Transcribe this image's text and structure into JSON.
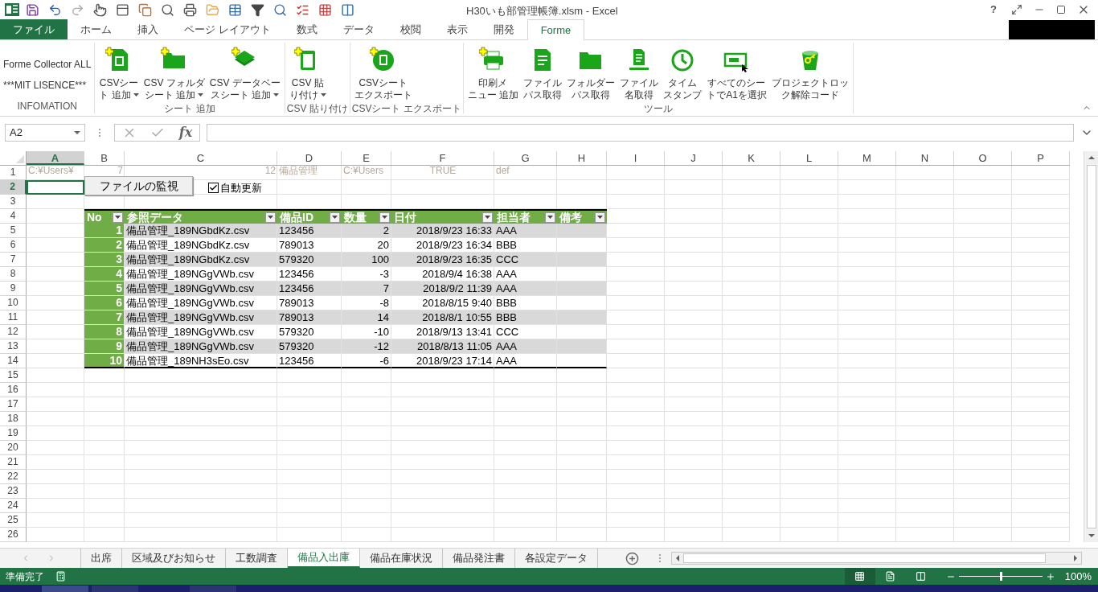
{
  "window": {
    "title": "H30いも部管理帳簿.xlsm - Excel",
    "help": "?"
  },
  "ribbon_tabs": [
    {
      "label": "ファイル",
      "kind": "file",
      "selected": false
    },
    {
      "label": "ホーム",
      "kind": "tab",
      "selected": false
    },
    {
      "label": "挿入",
      "kind": "tab",
      "selected": false
    },
    {
      "label": "ページ レイアウト",
      "kind": "tab",
      "selected": false
    },
    {
      "label": "数式",
      "kind": "tab",
      "selected": false
    },
    {
      "label": "データ",
      "kind": "tab",
      "selected": false
    },
    {
      "label": "校閲",
      "kind": "tab",
      "selected": false
    },
    {
      "label": "表示",
      "kind": "tab",
      "selected": false
    },
    {
      "label": "開発",
      "kind": "tab",
      "selected": false
    },
    {
      "label": "Forme",
      "kind": "tab",
      "selected": true
    }
  ],
  "ribbon_groups": [
    {
      "label": "INFOMATION",
      "kind": "info",
      "lines": [
        "Forme Collector ALL",
        "***MIT LISENCE***"
      ]
    },
    {
      "label": "シート 追加",
      "kind": "buttons",
      "buttons": [
        {
          "lines": [
            "CSVシー",
            "ト 追加"
          ],
          "dropdown": true
        },
        {
          "lines": [
            "CSV フォルダ",
            "シート 追加"
          ],
          "dropdown": true
        },
        {
          "lines": [
            "CSV データベー",
            "スシート 追加"
          ],
          "dropdown": true
        }
      ]
    },
    {
      "label": "CSV 貼り付け",
      "kind": "buttons",
      "buttons": [
        {
          "lines": [
            "CSV 貼",
            "り付け"
          ],
          "dropdown": true
        }
      ]
    },
    {
      "label": "CSVシート エクスポート",
      "kind": "buttons",
      "buttons": [
        {
          "lines": [
            "CSVシート",
            "エクスポート"
          ],
          "dropdown": false
        }
      ]
    },
    {
      "label": "ツール",
      "kind": "buttons",
      "buttons": [
        {
          "lines": [
            "印刷メ",
            "ニュー 追加"
          ],
          "dropdown": false
        },
        {
          "lines": [
            "ファイル",
            "パス取得"
          ],
          "dropdown": false
        },
        {
          "lines": [
            "フォルダー",
            "パス取得"
          ],
          "dropdown": false
        },
        {
          "lines": [
            "ファイル",
            "名取得"
          ],
          "dropdown": false
        },
        {
          "lines": [
            "タイム",
            "スタンプ"
          ],
          "dropdown": false
        },
        {
          "lines": [
            "すべてのシー",
            "トでA1を選択"
          ],
          "dropdown": false
        },
        {
          "lines": [
            "プロジェクトロッ",
            "ク解除コード"
          ],
          "dropdown": false
        }
      ]
    }
  ],
  "formula_bar": {
    "name_box": "A2",
    "function_label": "fx"
  },
  "sheet": {
    "columns": [
      {
        "label": "A",
        "selected": true
      },
      {
        "label": "B",
        "selected": false
      },
      {
        "label": "C",
        "selected": false
      },
      {
        "label": "D",
        "selected": false
      },
      {
        "label": "E",
        "selected": false
      },
      {
        "label": "F",
        "selected": false
      },
      {
        "label": "G",
        "selected": false
      },
      {
        "label": "H",
        "selected": false
      },
      {
        "label": "I",
        "selected": false
      },
      {
        "label": "J",
        "selected": false
      },
      {
        "label": "K",
        "selected": false
      },
      {
        "label": "L",
        "selected": false
      },
      {
        "label": "M",
        "selected": false
      },
      {
        "label": "N",
        "selected": false
      },
      {
        "label": "O",
        "selected": false
      },
      {
        "label": "P",
        "selected": false
      }
    ],
    "rows": [
      {
        "label": "1",
        "selected": false
      },
      {
        "label": "2",
        "selected": true
      },
      {
        "label": "3",
        "selected": false
      },
      {
        "label": "4",
        "selected": false
      },
      {
        "label": "5",
        "selected": false
      },
      {
        "label": "6",
        "selected": false
      },
      {
        "label": "7",
        "selected": false
      },
      {
        "label": "8",
        "selected": false
      },
      {
        "label": "9",
        "selected": false
      },
      {
        "label": "10",
        "selected": false
      },
      {
        "label": "11",
        "selected": false
      },
      {
        "label": "12",
        "selected": false
      },
      {
        "label": "13",
        "selected": false
      },
      {
        "label": "14",
        "selected": false
      },
      {
        "label": "15",
        "selected": false
      },
      {
        "label": "16",
        "selected": false
      },
      {
        "label": "17",
        "selected": false
      },
      {
        "label": "18",
        "selected": false
      },
      {
        "label": "19",
        "selected": false
      },
      {
        "label": "20",
        "selected": false
      },
      {
        "label": "21",
        "selected": false
      },
      {
        "label": "22",
        "selected": false
      },
      {
        "label": "23",
        "selected": false
      },
      {
        "label": "24",
        "selected": false
      },
      {
        "label": "25",
        "selected": false
      },
      {
        "label": "26",
        "selected": false
      }
    ],
    "row1_cells": [
      {
        "text": "C:¥Users¥",
        "kind": "text"
      },
      {
        "text": "7",
        "kind": "number"
      },
      {
        "text": "12",
        "kind": "number"
      },
      {
        "text": "備品管理",
        "kind": "text"
      },
      {
        "text": "C:¥Users",
        "kind": "text"
      },
      {
        "text": "TRUE",
        "kind": "boolean"
      },
      {
        "text": "def",
        "kind": "text"
      }
    ]
  },
  "form_controls": {
    "button": "ファイルの監視",
    "checkbox": {
      "label": "自動更新",
      "checked": true
    }
  },
  "table": {
    "columns": [
      "No",
      "参照データ",
      "備品ID",
      "数量",
      "日付",
      "担当者",
      "備考"
    ],
    "rows": [
      [
        "1",
        "備品管理_189NGbdKz.csv",
        "123456",
        "2",
        "2018/9/23 16:33",
        "AAA"
      ],
      [
        "2",
        "備品管理_189NGbdKz.csv",
        "789013",
        "20",
        "2018/9/23 16:34",
        "BBB"
      ],
      [
        "3",
        "備品管理_189NGbdKz.csv",
        "579320",
        "100",
        "2018/9/23 16:35",
        "CCC"
      ],
      [
        "4",
        "備品管理_189NGgVWb.csv",
        "123456",
        "-3",
        "2018/9/4 16:38",
        "AAA"
      ],
      [
        "5",
        "備品管理_189NGgVWb.csv",
        "123456",
        "7",
        "2018/9/2 11:39",
        "AAA"
      ],
      [
        "6",
        "備品管理_189NGgVWb.csv",
        "789013",
        "-8",
        "2018/8/15 9:40",
        "BBB"
      ],
      [
        "7",
        "備品管理_189NGgVWb.csv",
        "789013",
        "14",
        "2018/8/1 10:55",
        "BBB"
      ],
      [
        "8",
        "備品管理_189NGgVWb.csv",
        "579320",
        "-10",
        "2018/9/13 13:41",
        "CCC"
      ],
      [
        "9",
        "備品管理_189NGgVWb.csv",
        "579320",
        "-12",
        "2018/8/13 11:05",
        "AAA"
      ],
      [
        "10",
        "備品管理_189NH3sEo.csv",
        "123456",
        "-6",
        "2018/9/23 17:14",
        "AAA"
      ]
    ]
  },
  "sheet_tabs": [
    {
      "label": "出席",
      "selected": false
    },
    {
      "label": "区域及びお知らせ",
      "selected": false
    },
    {
      "label": "工数調査",
      "selected": false
    },
    {
      "label": "備品入出庫",
      "selected": true
    },
    {
      "label": "備品在庫状況",
      "selected": false
    },
    {
      "label": "備品発注書",
      "selected": false
    },
    {
      "label": "各設定データ",
      "selected": false
    }
  ],
  "status_bar": {
    "status": "準備完了",
    "views": [
      {
        "selected": true
      },
      {
        "selected": false
      },
      {
        "selected": false
      }
    ],
    "zoom": {
      "level": 0.5
    },
    "zoom_label": "100%"
  }
}
